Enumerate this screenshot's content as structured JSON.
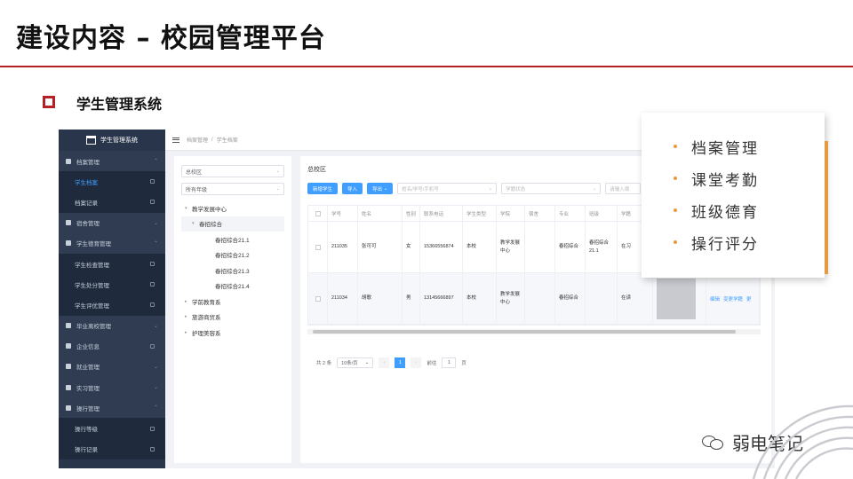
{
  "slide": {
    "title": "建设内容 – 校园管理平台",
    "section_title": "学生管理系统",
    "watermark": "弱电笔记",
    "accent_color": "#b52025",
    "highlight_color": "#e39a42"
  },
  "app": {
    "sidebar": {
      "system_title": "学生管理系统",
      "items": [
        {
          "label": "档案管理",
          "kind": "group",
          "chevron": "⌃"
        },
        {
          "label": "学生档案",
          "kind": "sub active",
          "lock": true
        },
        {
          "label": "档案记录",
          "kind": "sub",
          "lock": true
        },
        {
          "label": "宿舍管理",
          "kind": "group",
          "chevron": "⌄"
        },
        {
          "label": "学生德育管理",
          "kind": "group",
          "chevron": "⌃"
        },
        {
          "label": "学生检查管理",
          "kind": "sub",
          "lock": true
        },
        {
          "label": "学生处分管理",
          "kind": "sub",
          "lock": true
        },
        {
          "label": "学生评优管理",
          "kind": "sub",
          "lock": true
        },
        {
          "label": "毕业离校管理",
          "kind": "group",
          "chevron": "⌄"
        },
        {
          "label": "企业信息",
          "kind": "group",
          "lock": true
        },
        {
          "label": "就业管理",
          "kind": "group",
          "chevron": "⌄"
        },
        {
          "label": "实习管理",
          "kind": "group",
          "chevron": "⌄"
        },
        {
          "label": "操行管理",
          "kind": "group",
          "chevron": "⌃"
        },
        {
          "label": "操行等级",
          "kind": "sub",
          "lock": true
        },
        {
          "label": "操行记录",
          "kind": "sub",
          "lock": true
        }
      ]
    },
    "breadcrumb": [
      "档案管理",
      "学生档案"
    ],
    "tree": {
      "campus_select": "总校区",
      "grade_select": "所有年级",
      "nodes": [
        {
          "label": "教学发展中心",
          "level": "l1",
          "arrow": "▾"
        },
        {
          "label": "春招综合",
          "level": "l2",
          "arrow": "▾"
        },
        {
          "label": "春招综合21.1",
          "level": "l3",
          "arrow": ""
        },
        {
          "label": "春招综合21.2",
          "level": "l3",
          "arrow": ""
        },
        {
          "label": "春招综合21.3",
          "level": "l3",
          "arrow": ""
        },
        {
          "label": "春招综合21.4",
          "level": "l3",
          "arrow": ""
        },
        {
          "label": "学前教育系",
          "level": "l1",
          "arrow": "▸"
        },
        {
          "label": "旅游商贸系",
          "level": "l1",
          "arrow": "▸"
        },
        {
          "label": "护理美容系",
          "level": "l1",
          "arrow": "▸"
        }
      ]
    },
    "main": {
      "panel_title": "总校区",
      "toolbar": {
        "add_label": "新增学生",
        "import_label": "导入",
        "export_label": "导出",
        "search_placeholder": "姓名/学号/手机号",
        "status_placeholder": "学籍状态",
        "dorm_placeholder": "请输入宿"
      },
      "table": {
        "headers": [
          "学号",
          "姓名",
          "性别",
          "联系电话",
          "学生类型",
          "学院",
          "宿舍",
          "专业",
          "班级",
          "学籍"
        ],
        "rows": [
          {
            "id": "211035",
            "name": "张可可",
            "sex": "女",
            "phone": "15366556874",
            "type": "本校",
            "school": "教学发展中心",
            "dorm": "",
            "major": "春招综合",
            "class": "春招综合21.1",
            "status": "在习",
            "ops": []
          },
          {
            "id": "211034",
            "name": "胡歌",
            "sex": "男",
            "phone": "13145666897",
            "type": "本校",
            "school": "教学发展中心",
            "dorm": "",
            "major": "春招综合",
            "class": "",
            "status": "在读",
            "ops": [
              "编辑",
              "变更学籍",
              "更"
            ]
          }
        ]
      },
      "pager": {
        "total": "共 2 条",
        "page_size": "10条/页",
        "prev": "‹",
        "current": "1",
        "next": "›",
        "goto_label": "前往",
        "goto_value": "1",
        "page_unit": "页"
      }
    }
  },
  "card_items": [
    "档案管理",
    "课堂考勤",
    "班级德育",
    "操行评分"
  ]
}
